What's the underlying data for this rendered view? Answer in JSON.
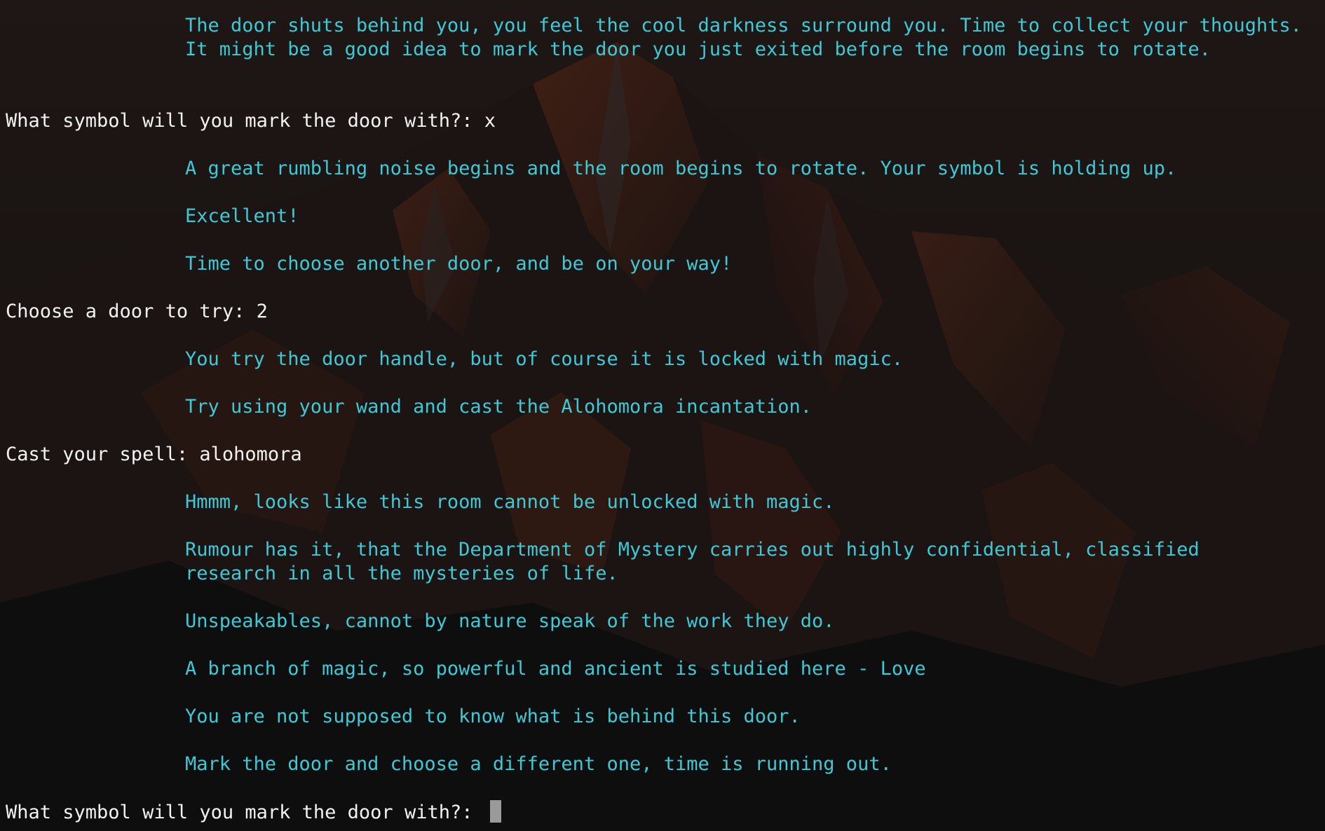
{
  "window": {
    "background_color": "#1c1818",
    "output_color": "#3ec9d6",
    "prompt_color": "#f2f2f2",
    "cursor_color": "#9a9a9a"
  },
  "transcript": {
    "narration": [
      "The door shuts behind you, you feel the cool darkness surround you. Time to collect your thoughts.",
      "It might be a good idea to mark the door you just exited before the room begins to rotate.",
      "A great rumbling noise begins and the room begins to rotate. Your symbol is holding up.",
      "Excellent!",
      "Time to choose another door, and be on your way!",
      "You try the door handle, but of course it is locked with magic.",
      "Try using your wand and cast the Alohomora incantation.",
      "Hmmm, looks like this room cannot be unlocked with magic.",
      "Rumour has it, that the Department of Mystery carries out highly confidential, classified",
      "research in all the mysteries of life.",
      "Unspeakables, cannot by nature speak of the work they do.",
      "A branch of magic, so powerful and ancient is studied here - Love",
      "You are not supposed to know what is behind this door.",
      "Mark the door and choose a different one, time is running out."
    ],
    "prompts": [
      "What symbol will you mark the door with?: x",
      "Choose a door to try: 2",
      "Cast your spell: alohomora"
    ],
    "active_prompt": "What symbol will you mark the door with?: "
  }
}
